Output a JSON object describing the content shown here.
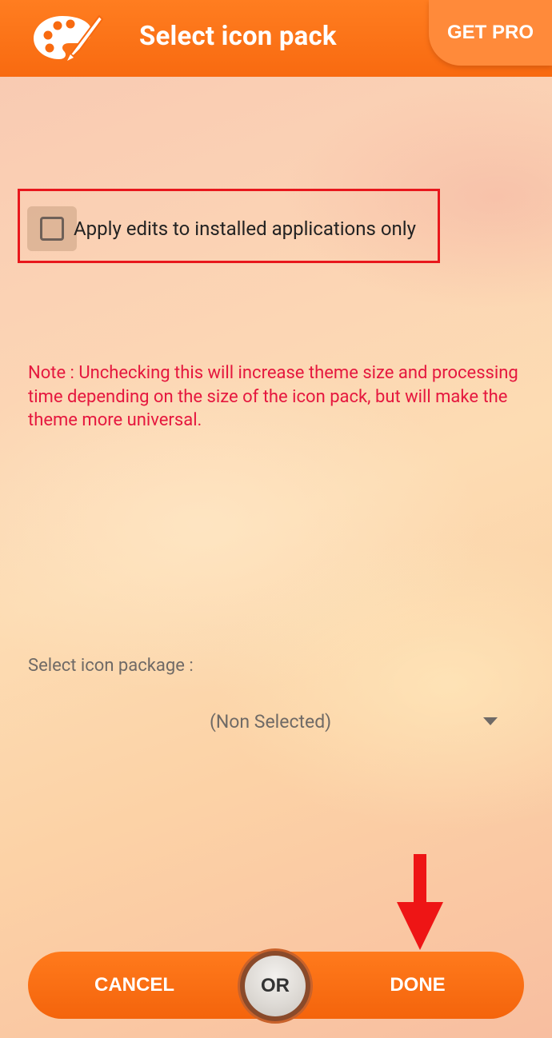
{
  "header": {
    "title": "Select icon pack",
    "get_pro_label": "GET PRO",
    "logo_icon": "palette-icon"
  },
  "options": {
    "apply_installed_only": {
      "label": "Apply edits to installed applications only",
      "checked": false
    },
    "note": "Note : Unchecking this will increase theme size and processing time depending on the size of the icon pack, but will make the theme more universal."
  },
  "icon_package": {
    "label": "Select icon package :",
    "selected": "(Non Selected)"
  },
  "footer": {
    "cancel_label": "CANCEL",
    "or_label": "OR",
    "done_label": "DONE"
  },
  "colors": {
    "header_orange": "#f86a10",
    "note_red": "#e5173e",
    "highlight_red": "#e8171c"
  }
}
